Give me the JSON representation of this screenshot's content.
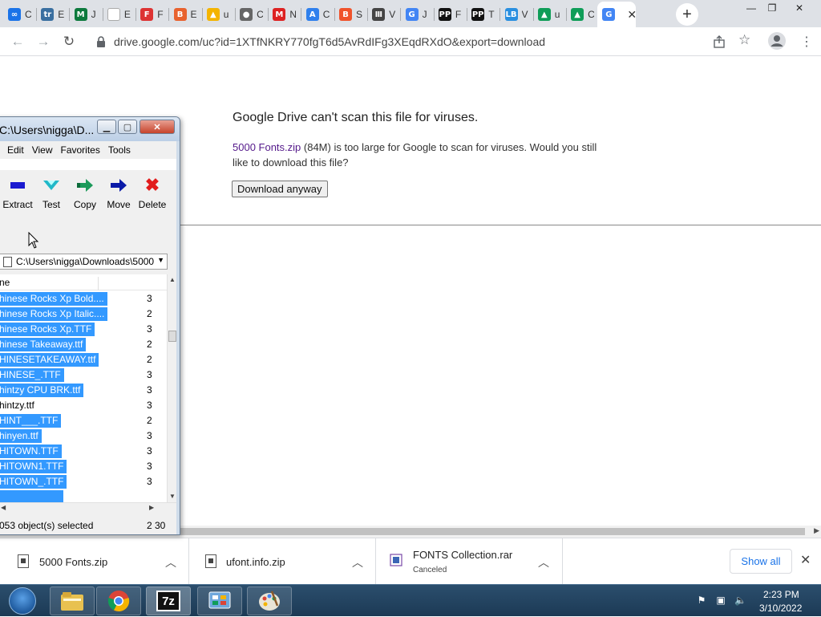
{
  "browser": {
    "tabs": [
      {
        "title": "C",
        "icon": "circle-icon",
        "color": "#1a73e8",
        "glyph": "∞"
      },
      {
        "title": "E",
        "icon": "trello-icon",
        "color": "#3a6fa0",
        "glyph": "tr"
      },
      {
        "title": "J",
        "icon": "m-icon",
        "color": "#0d7a3d",
        "glyph": "M"
      },
      {
        "title": "E",
        "icon": "blank-icon",
        "color": "#ffffff",
        "glyph": ""
      },
      {
        "title": "F",
        "icon": "f-icon",
        "color": "#d33",
        "glyph": "F"
      },
      {
        "title": "E",
        "icon": "b-icon",
        "color": "#e8622e",
        "glyph": "B"
      },
      {
        "title": "u",
        "icon": "drive-icon",
        "color": "#f4b400",
        "glyph": "▲"
      },
      {
        "title": "C",
        "icon": "globe-icon",
        "color": "#666",
        "glyph": "●"
      },
      {
        "title": "N",
        "icon": "m-red-icon",
        "color": "#d22",
        "glyph": "M"
      },
      {
        "title": "C",
        "icon": "appstore-icon",
        "color": "#2f80ed",
        "glyph": "A"
      },
      {
        "title": "S",
        "icon": "brave-icon",
        "color": "#f0532b",
        "glyph": "B"
      },
      {
        "title": "V",
        "icon": "museum-icon",
        "color": "#444",
        "glyph": "Ⅲ"
      },
      {
        "title": "J",
        "icon": "google-icon",
        "color": "#4285f4",
        "glyph": "G"
      },
      {
        "title": "F",
        "icon": "pp-icon",
        "color": "#111",
        "glyph": "PP"
      },
      {
        "title": "T",
        "icon": "pp-icon",
        "color": "#111",
        "glyph": "PP"
      },
      {
        "title": "V",
        "icon": "lb-icon",
        "color": "#2a8fe0",
        "glyph": "LB"
      },
      {
        "title": "u",
        "icon": "drive-icon",
        "color": "#0f9d58",
        "glyph": "▲"
      },
      {
        "title": "C",
        "icon": "drive-icon",
        "color": "#0f9d58",
        "glyph": "▲"
      },
      {
        "title": "G",
        "icon": "google-icon",
        "color": "#4285f4",
        "glyph": "G"
      }
    ],
    "url": "drive.google.com/uc?id=1XTfNKRY770fgT6d5AvRdIFg3XEqdRXdO&export=download"
  },
  "page": {
    "title": "Google Drive can't scan this file for viruses.",
    "file_link": "5000 Fonts.zip",
    "message_rest": " (84M) is too large for Google to scan for viruses. Would you still like to download this file?",
    "download_button": "Download anyway"
  },
  "downloads": {
    "items": [
      {
        "name": "5000 Fonts.zip",
        "status": ""
      },
      {
        "name": "ufont.info.zip",
        "status": ""
      },
      {
        "name": "FONTS Collection.rar",
        "status": "Canceled"
      }
    ],
    "show_all": "Show all"
  },
  "zip": {
    "title": "C:\\Users\\nigga\\D...",
    "menu": [
      "Edit",
      "View",
      "Favorites",
      "Tools"
    ],
    "tools": [
      {
        "label": "Extract",
        "icon": "extract-icon"
      },
      {
        "label": "Test",
        "icon": "test-icon"
      },
      {
        "label": "Copy",
        "icon": "copy-icon"
      },
      {
        "label": "Move",
        "icon": "move-icon"
      },
      {
        "label": "Delete",
        "icon": "delete-icon"
      }
    ],
    "path": "C:\\Users\\nigga\\Downloads\\5000",
    "column_name": "ne",
    "rows": [
      {
        "name": "hinese Rocks Xp Bold....",
        "size": "3",
        "selected": true
      },
      {
        "name": "hinese Rocks Xp Italic....",
        "size": "2",
        "selected": true
      },
      {
        "name": "hinese Rocks Xp.TTF",
        "size": "3",
        "selected": true
      },
      {
        "name": "hinese Takeaway.ttf",
        "size": "2",
        "selected": true
      },
      {
        "name": "HINESETAKEAWAY.ttf",
        "size": "2",
        "selected": true
      },
      {
        "name": "HINESE_.TTF",
        "size": "3",
        "selected": true
      },
      {
        "name": "hintzy CPU BRK.ttf",
        "size": "3",
        "selected": true
      },
      {
        "name": "hintzy.ttf",
        "size": "3",
        "selected": false
      },
      {
        "name": "HINT___.TTF",
        "size": "2",
        "selected": true
      },
      {
        "name": "hinyen.ttf",
        "size": "3",
        "selected": true
      },
      {
        "name": "HITOWN.TTF",
        "size": "3",
        "selected": true
      },
      {
        "name": "HITOWN1.TTF",
        "size": "3",
        "selected": true
      },
      {
        "name": "HITOWN_.TTF",
        "size": "3",
        "selected": true
      }
    ],
    "status_left": "053 object(s) selected",
    "status_right": "2 30"
  },
  "clock": {
    "time": "2:23 PM",
    "date": "3/10/2022"
  }
}
